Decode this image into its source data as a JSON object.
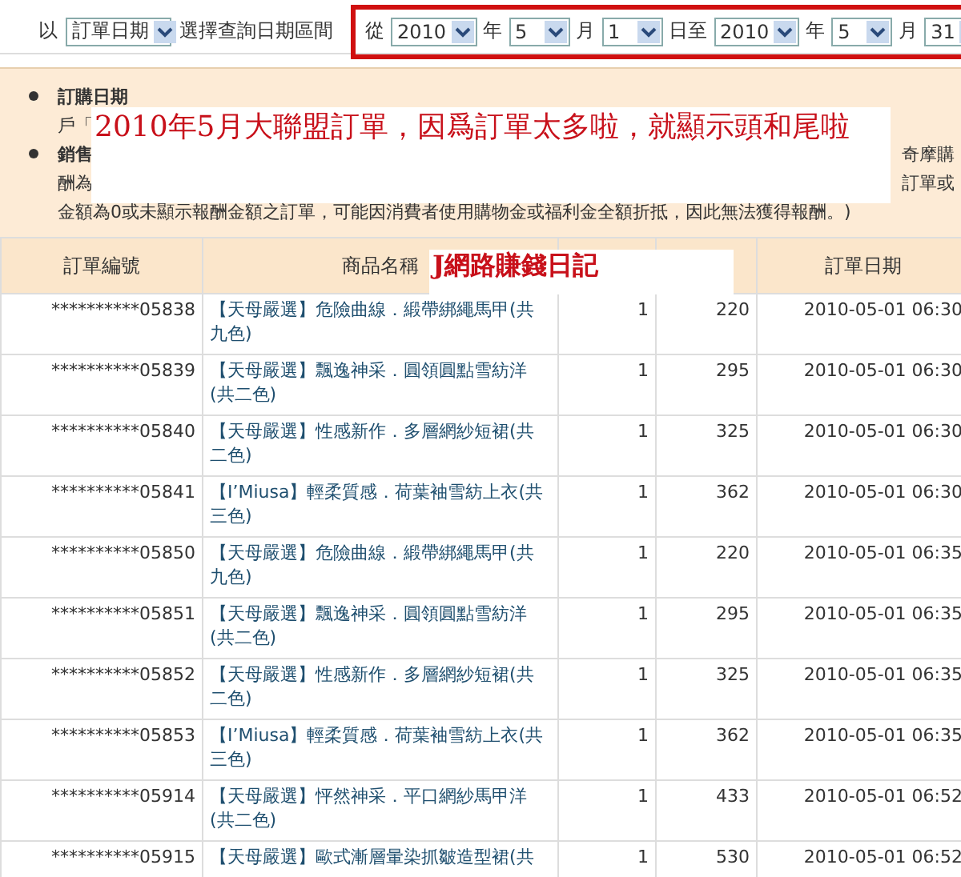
{
  "filter": {
    "prefix": "以",
    "date_type": "訂單日期",
    "hint": "選擇查詢日期區間"
  },
  "range": [
    {
      "kind": "label",
      "text": "從"
    },
    {
      "kind": "select",
      "text": "2010"
    },
    {
      "kind": "label",
      "text": "年"
    },
    {
      "kind": "select",
      "text": "5"
    },
    {
      "kind": "label",
      "text": "月"
    },
    {
      "kind": "select",
      "text": "1"
    },
    {
      "kind": "label",
      "text": "日至"
    },
    {
      "kind": "select",
      "text": "2010"
    },
    {
      "kind": "label",
      "text": "年"
    },
    {
      "kind": "select",
      "text": "5"
    },
    {
      "kind": "label",
      "text": "月"
    },
    {
      "kind": "select",
      "text": "31"
    }
  ],
  "notice": [
    {
      "bullet": true,
      "left": "訂購日期"
    },
    {
      "bullet": false,
      "left": "戶「"
    },
    {
      "bullet": true,
      "left": "銷售",
      "right": "奇摩購"
    },
    {
      "bullet": false,
      "left": "酬為",
      "right": "訂單或"
    },
    {
      "bullet": false,
      "left": "金額為0或未顯示報酬金額之訂單，可能因消費者使用購物金或福利金全額折抵，因此無法獲得報酬。)"
    }
  ],
  "overlay_caption": "2010年5月大聯盟訂單，因爲訂單太多啦，就顯示頭和尾啦",
  "overlay_watermark": "J網路賺錢日記",
  "table": {
    "header": {
      "order_no": "訂單編號",
      "product": "商品名稱",
      "date": "訂單日期"
    },
    "rows": [
      {
        "order_no": "**********05838",
        "product": "【天母嚴選】危險曲線．緞帶綁繩馬甲(共九色)",
        "qty": "1",
        "price": "220",
        "date": "2010-05-01 06:30"
      },
      {
        "order_no": "**********05839",
        "product": "【天母嚴選】飄逸神采．圓領圓點雪紡洋(共二色)",
        "qty": "1",
        "price": "295",
        "date": "2010-05-01 06:30"
      },
      {
        "order_no": "**********05840",
        "product": "【天母嚴選】性感新作．多層網紗短裙(共二色)",
        "qty": "1",
        "price": "325",
        "date": "2010-05-01 06:30"
      },
      {
        "order_no": "**********05841",
        "product": "【I’Miusa】輕柔質感．荷葉袖雪紡上衣(共三色)",
        "qty": "1",
        "price": "362",
        "date": "2010-05-01 06:30"
      },
      {
        "order_no": "**********05850",
        "product": "【天母嚴選】危險曲線．緞帶綁繩馬甲(共九色)",
        "qty": "1",
        "price": "220",
        "date": "2010-05-01 06:35"
      },
      {
        "order_no": "**********05851",
        "product": "【天母嚴選】飄逸神采．圓領圓點雪紡洋(共二色)",
        "qty": "1",
        "price": "295",
        "date": "2010-05-01 06:35"
      },
      {
        "order_no": "**********05852",
        "product": "【天母嚴選】性感新作．多層網紗短裙(共二色)",
        "qty": "1",
        "price": "325",
        "date": "2010-05-01 06:35"
      },
      {
        "order_no": "**********05853",
        "product": "【I’Miusa】輕柔質感．荷葉袖雪紡上衣(共三色)",
        "qty": "1",
        "price": "362",
        "date": "2010-05-01 06:35"
      },
      {
        "order_no": "**********05914",
        "product": "【天母嚴選】怦然神采．平口網紗馬甲洋(共二色)",
        "qty": "1",
        "price": "433",
        "date": "2010-05-01 06:52"
      },
      {
        "order_no": "**********05915",
        "product": "【天母嚴選】歐式漸層暈染抓皺造型裙(共",
        "qty": "1",
        "price": "530",
        "date": "2010-05-01 06:52"
      }
    ]
  }
}
